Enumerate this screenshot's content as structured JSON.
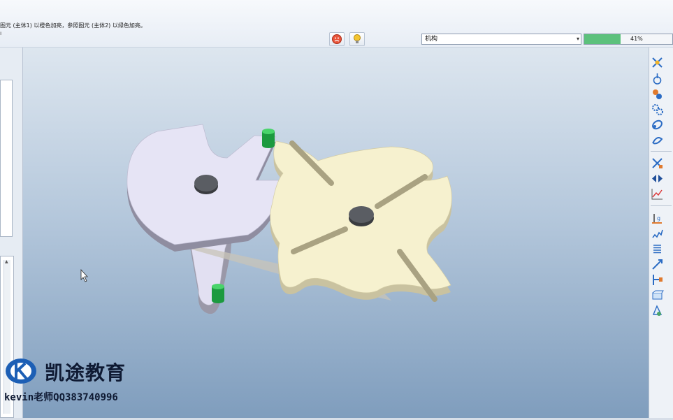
{
  "message": {
    "text": "图元 (主体1) 以橙色加亮，参照图元 (主体2) 以绿色加亮。",
    "mark": "ı"
  },
  "toolbar": {
    "stop_icon": "stop-face-icon",
    "bulb_icon": "lightbulb-icon"
  },
  "mechanism_select": {
    "value": "机构"
  },
  "progress": {
    "percent": 41,
    "label": "41%",
    "fill_color": "#5cc17c"
  },
  "viewport": {
    "model": "geneva-mechanism",
    "colors": {
      "driver_wheel": "#e6e4f5",
      "geneva_wheel": "#f6f1cf",
      "pins": "#22b34a",
      "hubs": "#4a4d52",
      "background_top": "#dde6ef",
      "background_bottom": "#7f9dbd"
    }
  },
  "right_toolbar": {
    "icons": [
      "servo-motor-icon",
      "connection-icon",
      "cam-icon",
      "gear-icon",
      "belt-icon",
      "slot-icon",
      "mechanism-analysis-icon",
      "playback-icon",
      "measure-icon",
      "gravity-icon",
      "spring-icon",
      "damper-icon",
      "force-icon",
      "initial-condition-icon",
      "mass-property-icon",
      "body-icon"
    ]
  },
  "watermark": {
    "name": "凯途教育",
    "contact": "kevin老师QQ383740996"
  }
}
